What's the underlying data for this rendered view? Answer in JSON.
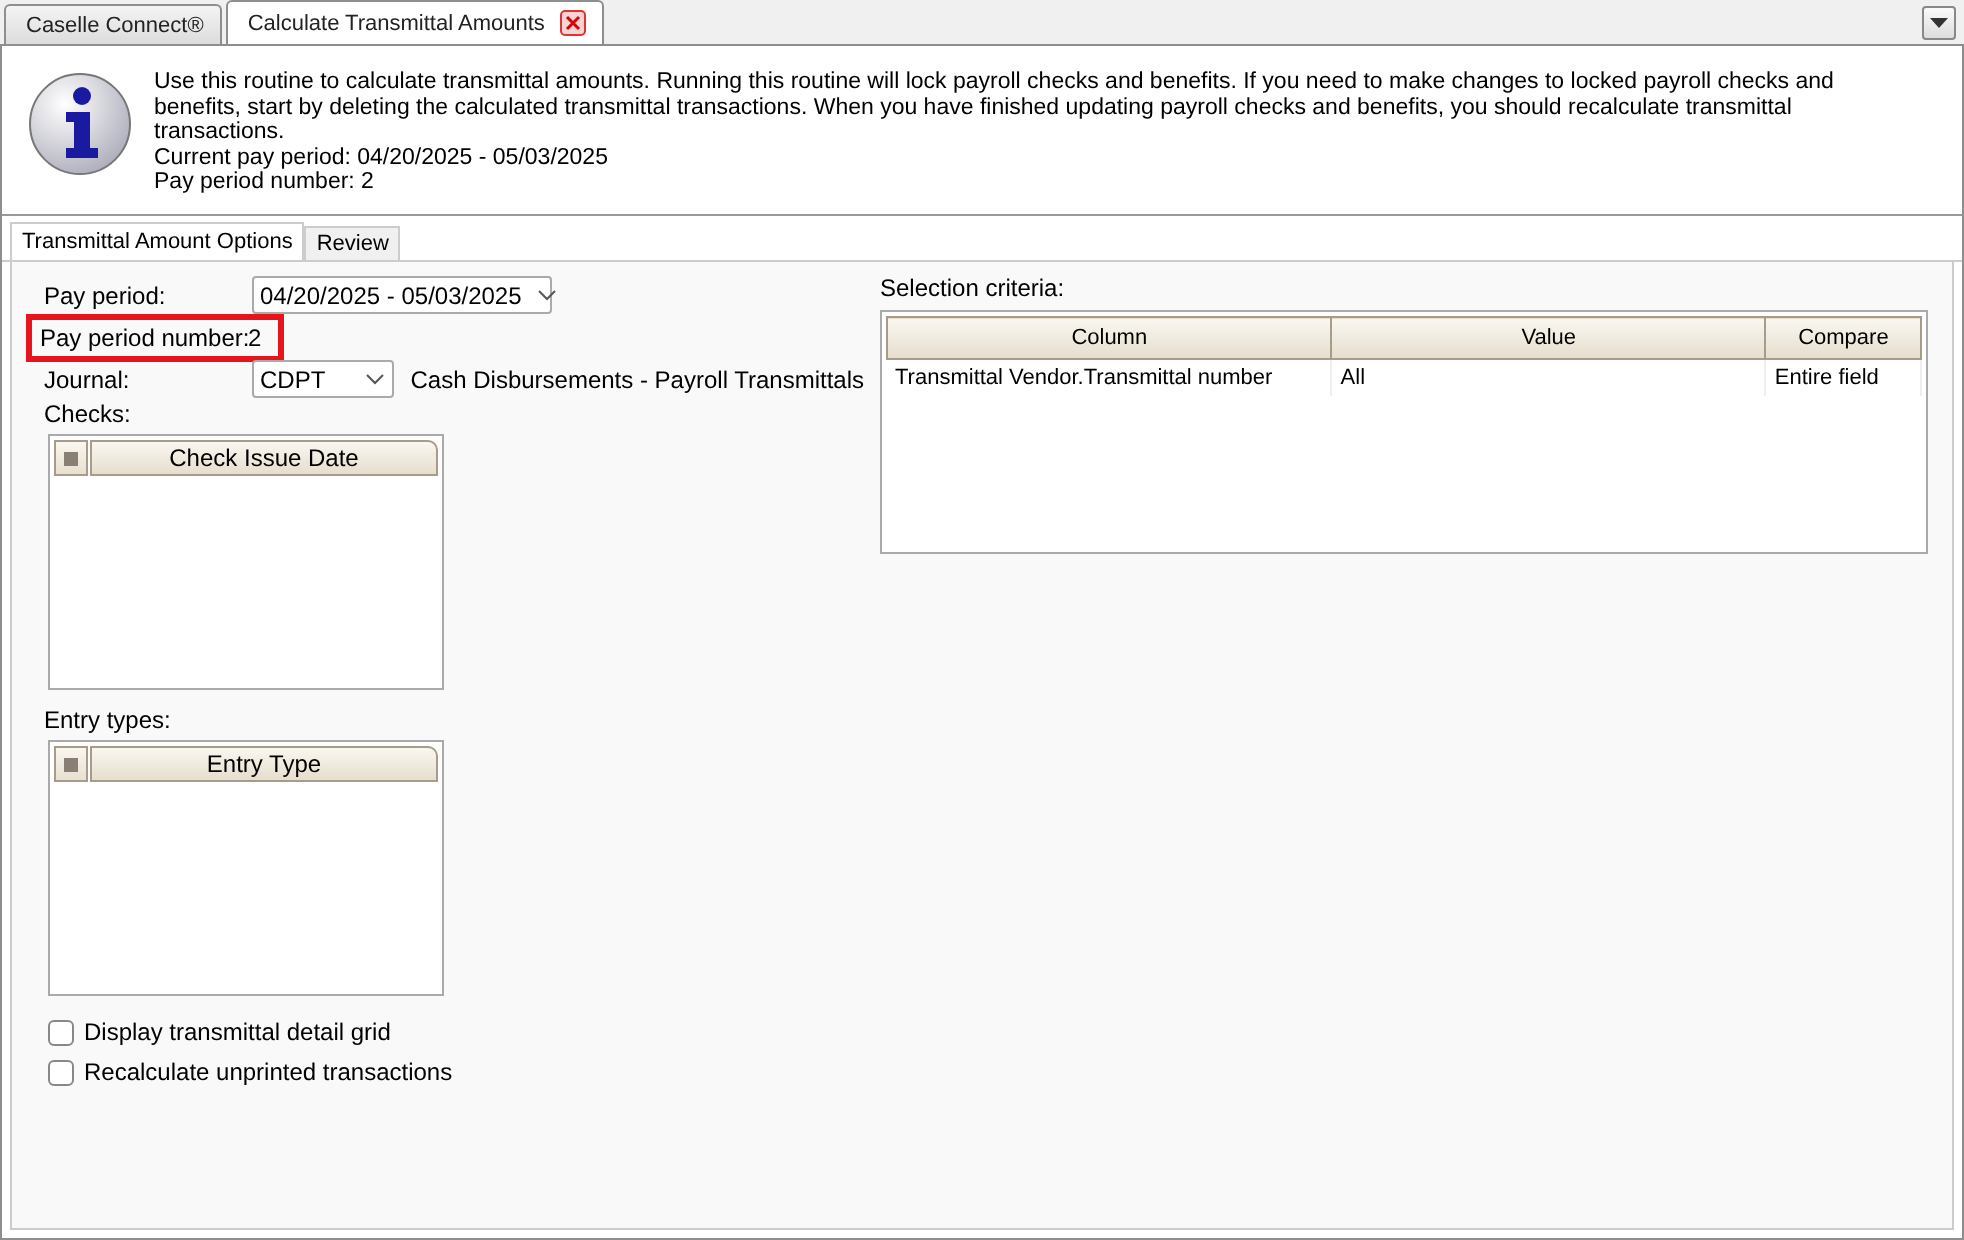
{
  "tabs": [
    {
      "label": "Caselle Connect®",
      "selected": false,
      "closable": false
    },
    {
      "label": "Calculate Transmittal Amounts",
      "selected": true,
      "closable": true
    }
  ],
  "info": {
    "message": "Use this routine to calculate transmittal amounts. Running this routine will lock payroll checks and benefits. If you need to make changes to locked payroll checks and benefits, start by deleting the calculated transmittal transactions. When you have finished updating payroll checks and benefits, you should recalculate transmittal transactions.",
    "current_pay_period": "Current pay period: 04/20/2025 - 05/03/2025",
    "pay_period_number": "Pay period number: 2"
  },
  "subtabs": [
    {
      "label": "Transmittal Amount Options",
      "selected": true
    },
    {
      "label": "Review",
      "selected": false
    }
  ],
  "form": {
    "pay_period": {
      "label": "Pay period:",
      "value": "04/20/2025 - 05/03/2025"
    },
    "pay_period_number": {
      "label": "Pay period number:",
      "value": "2",
      "highlighted": true
    },
    "journal": {
      "label": "Journal:",
      "value": "CDPT",
      "description": "Cash Disbursements - Payroll Transmittals"
    },
    "checks": {
      "label": "Checks:",
      "column": "Check Issue Date",
      "partially_checked": true
    },
    "entry_types": {
      "label": "Entry types:",
      "column": "Entry Type",
      "partially_checked": true
    },
    "options": [
      {
        "label": "Display transmittal detail grid",
        "checked": false
      },
      {
        "label": "Recalculate unprinted transactions",
        "checked": false
      }
    ]
  },
  "selection_criteria": {
    "label": "Selection criteria:",
    "columns": [
      "Column",
      "Value",
      "Compare"
    ],
    "rows": [
      [
        "Transmittal Vendor.Transmittal number",
        "All",
        "Entire field"
      ]
    ]
  }
}
